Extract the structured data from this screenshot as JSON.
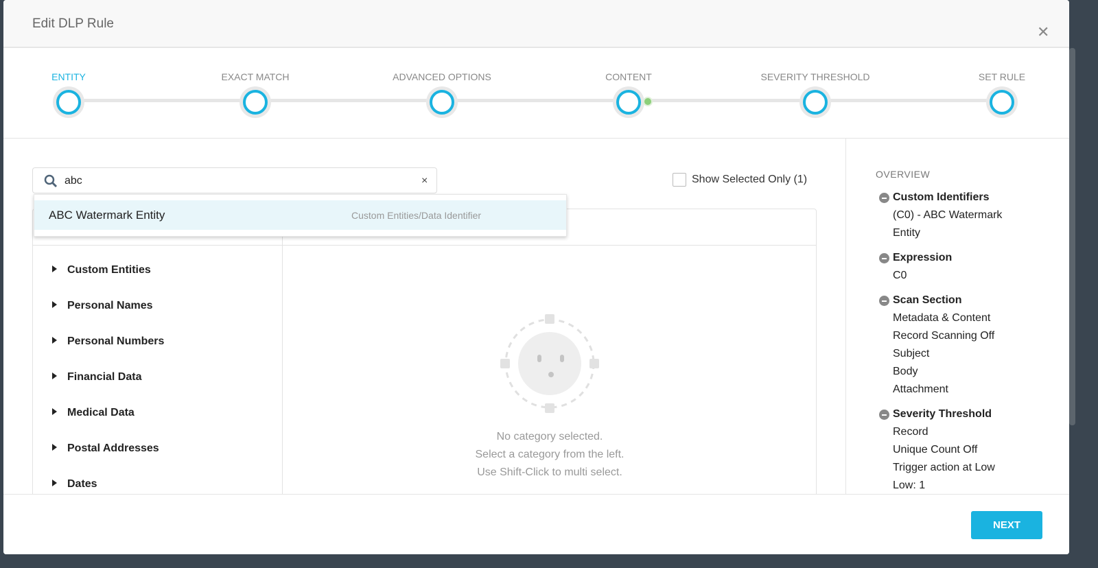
{
  "header": {
    "title": "Edit DLP Rule",
    "close_icon": "close-icon"
  },
  "steps": [
    {
      "label": "ENTITY",
      "active": true
    },
    {
      "label": "EXACT MATCH"
    },
    {
      "label": "ADVANCED OPTIONS"
    },
    {
      "label": "CONTENT"
    },
    {
      "label": "SEVERITY THRESHOLD"
    },
    {
      "label": "SET RULE"
    }
  ],
  "colors": {
    "accent": "#1ab3e0",
    "progress_dot": "#8ccf7a"
  },
  "search": {
    "value": "abc",
    "clear": "×"
  },
  "show_selected": {
    "label": "Show Selected Only (1)",
    "checked": false
  },
  "dropdown": [
    {
      "name": "ABC Watermark Entity",
      "type": "Custom Entities/Data Identifier"
    }
  ],
  "categories": [
    "Custom Entities",
    "Personal Names",
    "Personal Numbers",
    "Financial Data",
    "Medical Data",
    "Postal Addresses",
    "Dates"
  ],
  "empty": {
    "line1": "No category selected.",
    "line2": "Select a category from the left.",
    "line3": "Use Shift-Click to multi select."
  },
  "overview": {
    "title": "OVERVIEW",
    "groups": [
      {
        "heading": "Custom Identifiers",
        "values": [
          "(C0) - ABC Watermark",
          "Entity"
        ]
      },
      {
        "heading": "Expression",
        "values": [
          "C0"
        ]
      },
      {
        "heading": "Scan Section",
        "values": [
          "Metadata & Content",
          "Record Scanning Off",
          "Subject",
          "Body",
          "Attachment"
        ]
      },
      {
        "heading": "Severity Threshold",
        "values": [
          "Record",
          "Unique Count Off",
          "Trigger action at Low",
          "Low: 1"
        ]
      }
    ]
  },
  "footer": {
    "next": "NEXT"
  }
}
